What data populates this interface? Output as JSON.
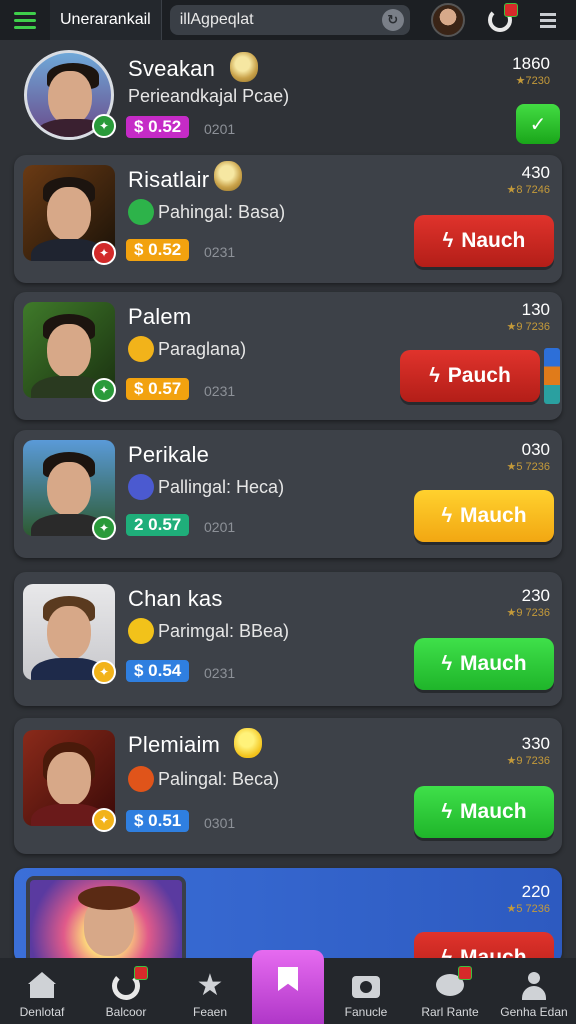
{
  "topbar": {
    "tab_label": "Unerarankail",
    "search_value": "illAgpeqlat"
  },
  "rows": [
    {
      "name": "Sveakan",
      "subtitle": "Perieandkajal Pcae)",
      "price": "$ 0.52",
      "code": "0201",
      "score": "1860",
      "stars": "★7230",
      "price_color": "#c52bc7",
      "action": null
    },
    {
      "name": "Risatlair",
      "subtitle": "Pahingal: Basa)",
      "price": "$ 0.52",
      "code": "0231",
      "score": "430",
      "stars": "★8 7246",
      "price_color": "#f2a20f",
      "action": {
        "label": "Nauch",
        "style": "red"
      }
    },
    {
      "name": "Palem",
      "subtitle": "Paraglana)",
      "price": "$ 0.57",
      "code": "0231",
      "score": "130",
      "stars": "★9 7236",
      "price_color": "#f2a20f",
      "action": {
        "label": "Pauch",
        "style": "red"
      }
    },
    {
      "name": "Perikale",
      "subtitle": "Pallingal: Heca)",
      "price": "2 0.57",
      "code": "0201",
      "score": "030",
      "stars": "★5 7236",
      "price_color": "#1fae7a",
      "action": {
        "label": "Mauch",
        "style": "yellow"
      }
    },
    {
      "name": "Chan kas",
      "subtitle": "Parimgal: BBea)",
      "price": "$ 0.54",
      "code": "0231",
      "score": "230",
      "stars": "★9 7236",
      "price_color": "#2f7fe0",
      "action": {
        "label": "Mauch",
        "style": "green"
      }
    },
    {
      "name": "Plemiaim",
      "subtitle": "Palingal: Beca)",
      "price": "$ 0.51",
      "code": "0301",
      "score": "330",
      "stars": "★9 7236",
      "price_color": "#2f7fe0",
      "action": {
        "label": "Mauch",
        "style": "green"
      }
    },
    {
      "name": "",
      "subtitle": "",
      "price": "",
      "code": "",
      "score": "220",
      "stars": "★5 7236",
      "price_color": "#2f7fe0",
      "action": {
        "label": "Mauch",
        "style": "red"
      }
    }
  ],
  "nav": [
    {
      "label": "Denlotaf",
      "icon": "home-icon"
    },
    {
      "label": "Balcoor",
      "icon": "refresh-icon"
    },
    {
      "label": "Feaen",
      "icon": "star-icon"
    },
    {
      "label": "",
      "icon": "bookmark-icon"
    },
    {
      "label": "Fanucle",
      "icon": "camera-icon"
    },
    {
      "label": "Rarl Rante",
      "icon": "chat-icon"
    },
    {
      "label": "Genha Edan",
      "icon": "user-icon"
    }
  ],
  "colors": {
    "background": "#2f3237",
    "card": "#3d4148",
    "accent_green": "#3fcf4b"
  }
}
